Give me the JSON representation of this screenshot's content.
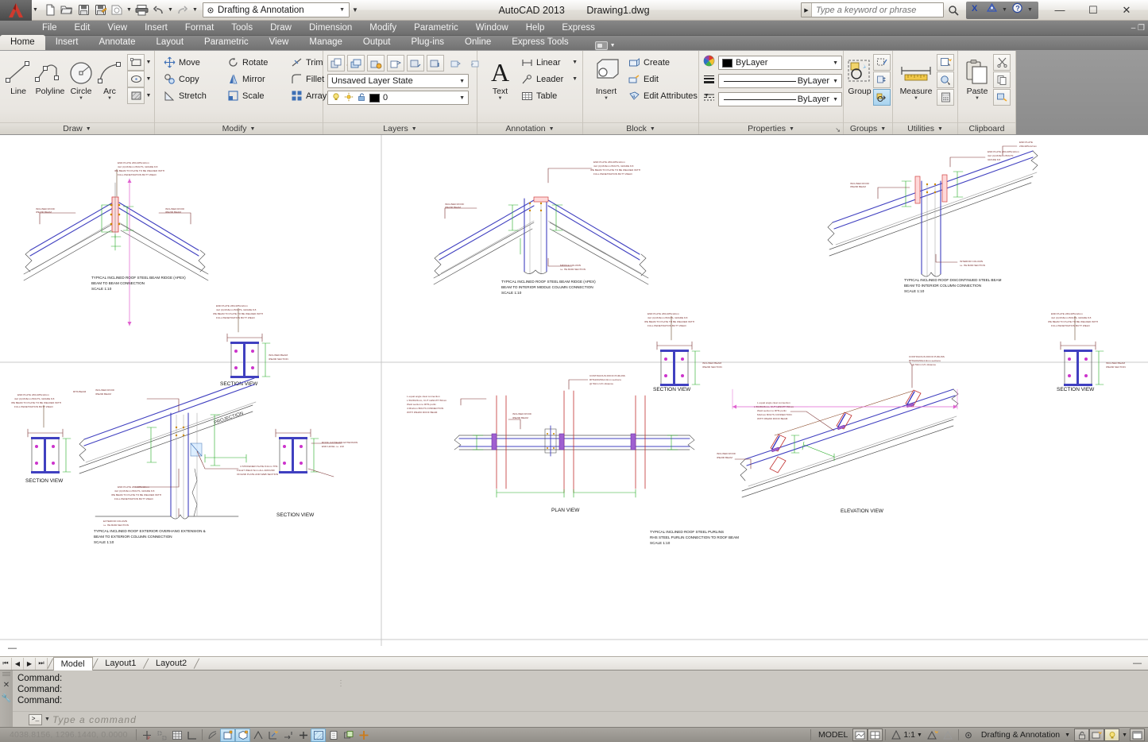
{
  "titlebar": {
    "app_name": "AutoCAD 2013",
    "document": "Drawing1.dwg",
    "workspace": "Drafting & Annotation",
    "quick_access": [
      {
        "name": "new-button",
        "label": "New"
      },
      {
        "name": "open-button",
        "label": "Open"
      },
      {
        "name": "save-button",
        "label": "Save"
      },
      {
        "name": "saveas-button",
        "label": "Save As"
      },
      {
        "name": "plot-preview-button",
        "label": "Plot Preview"
      },
      {
        "name": "plot-button",
        "label": "Plot"
      },
      {
        "name": "undo-button",
        "label": "Undo"
      },
      {
        "name": "redo-button",
        "label": "Redo"
      }
    ],
    "search_placeholder": "Type a keyword or phrase",
    "minimize": "—",
    "maximize": "☐",
    "close": "✕"
  },
  "menubar": {
    "items": [
      "File",
      "Edit",
      "View",
      "Insert",
      "Format",
      "Tools",
      "Draw",
      "Dimension",
      "Modify",
      "Parametric",
      "Window",
      "Help",
      "Express"
    ],
    "restore_glyph": "– ❐"
  },
  "ribbon_tabs": {
    "items": [
      "Home",
      "Insert",
      "Annotate",
      "Layout",
      "Parametric",
      "View",
      "Manage",
      "Output",
      "Plug-ins",
      "Online",
      "Express Tools"
    ],
    "active": "Home"
  },
  "panels": {
    "draw": {
      "title": "Draw",
      "big_buttons": [
        {
          "name": "line-tool",
          "label": "Line",
          "has_dropdown": false
        },
        {
          "name": "polyline-tool",
          "label": "Polyline",
          "has_dropdown": false
        },
        {
          "name": "circle-tool",
          "label": "Circle",
          "has_dropdown": true
        },
        {
          "name": "arc-tool",
          "label": "Arc",
          "has_dropdown": true
        }
      ],
      "small_buttons": [
        {
          "name": "rectangle-tool",
          "label": "Rectangle"
        },
        {
          "name": "ellipse-tool",
          "label": "Ellipse"
        },
        {
          "name": "hatch-tool",
          "label": "Hatch"
        }
      ]
    },
    "modify": {
      "title": "Modify",
      "items": [
        {
          "name": "move-tool",
          "label": "Move",
          "dropdown": false
        },
        {
          "name": "rotate-tool",
          "label": "Rotate",
          "dropdown": false
        },
        {
          "name": "trim-tool",
          "label": "Trim",
          "dropdown": true
        },
        {
          "name": "copy-tool",
          "label": "Copy",
          "dropdown": false
        },
        {
          "name": "mirror-tool",
          "label": "Mirror",
          "dropdown": false
        },
        {
          "name": "fillet-tool",
          "label": "Fillet",
          "dropdown": true
        },
        {
          "name": "stretch-tool",
          "label": "Stretch",
          "dropdown": false
        },
        {
          "name": "scale-tool",
          "label": "Scale",
          "dropdown": false
        },
        {
          "name": "array-tool",
          "label": "Array",
          "dropdown": true
        }
      ]
    },
    "layers": {
      "title": "Layers",
      "layer_state": "Unsaved Layer State",
      "current_layer": "0",
      "layer_color": "#000000"
    },
    "annotation": {
      "title": "Annotation",
      "text_label": "Text",
      "items": [
        {
          "name": "linear-dimension-tool",
          "label": "Linear",
          "dropdown": true
        },
        {
          "name": "leader-tool",
          "label": "Leader",
          "dropdown": true
        },
        {
          "name": "table-tool",
          "label": "Table",
          "dropdown": false
        }
      ]
    },
    "block": {
      "title": "Block",
      "insert_label": "Insert",
      "items": [
        {
          "name": "create-block-tool",
          "label": "Create",
          "dropdown": false
        },
        {
          "name": "edit-block-tool",
          "label": "Edit",
          "dropdown": false
        },
        {
          "name": "edit-attributes-tool",
          "label": "Edit Attributes",
          "dropdown": true
        }
      ]
    },
    "properties": {
      "title": "Properties",
      "color": "ByLayer",
      "linewidth": "ByLayer",
      "linetype": "ByLayer",
      "color_swatch": "#000000"
    },
    "groups": {
      "title": "Groups",
      "group_label": "Group"
    },
    "utilities": {
      "title": "Utilities",
      "measure_label": "Measure"
    },
    "clipboard": {
      "title": "Clipboard",
      "paste_label": "Paste"
    }
  },
  "drawing": {
    "details": [
      {
        "name": "detail-ridge-beam-to-beam",
        "title_lines": [
          "TYPICAL INCLINED ROOF STEEL BEAM RIDGE (APEX)",
          "BEAM TO BEAM CONNECTION",
          "SCALE 1:10"
        ],
        "section_label": "SECTION VIEW",
        "notes": [
          "END PLATE 230x185x12mm",
          "4x2 (4) M16mm BOLTS, GRADE 8.8",
          "IPE BEAM TO PLATE TO BE WELDED WITH",
          "FULL PENETRATION BUTT WELD",
          "INCLINED ROOF IPE200 BEAM"
        ]
      },
      {
        "name": "detail-ridge-to-middle-column",
        "title_lines": [
          "TYPICAL INCLINED ROOF STEEL BEAM RIDGE (APEX)",
          "BEAM TO INTERIOR MIDDLE COLUMN CONNECTION",
          "SCALE 1:10"
        ],
        "section_label": "SECTION VIEW",
        "notes": [
          "END PLATE 230x185x12mm",
          "4x2 (4) M16mm BOLTS, GRADE 8.8",
          "IPE BEAM TO PLATE TO BE WELDED WITH",
          "FULL PENETRATION BUTT WELD",
          "MIDDLE COLUMN i.e. HE B200 SECTION"
        ]
      },
      {
        "name": "detail-discontinued-beam-to-interior-column",
        "title_lines": [
          "TYPICAL INCLINED ROOF DISCONTINUED STEEL BEAM",
          "BEAM TO INTERIOR COLUMN CONNECTION",
          "SCALE 1:10"
        ],
        "section_label": "SECTION VIEW",
        "notes": [
          "END PLATE 230x185x12mm",
          "4x2 (4) M16mm BOLTS, GRADE 8.8",
          "IPE BEAM TO PLATE TO BE WELDED WITH",
          "FULL PENETRATION BUTT WELD",
          "INTERIOR COLUMN i.e. HE B200 SECTION"
        ]
      },
      {
        "name": "detail-exterior-overhang-extension",
        "title_lines": [
          "TYPICAL INCLINED ROOF EXTERIOR OVERHANG  EXTENSION &",
          "BEAM TO EXTERIOR COLUMN CONNECTION",
          "SCALE 1:10"
        ],
        "section_label": "SECTION VIEW",
        "notes": [
          "END PLATE 230x185x12mm",
          "4x2 (4) M16mm BOLTS, GRADE 8.8",
          "IPE BEAM TO PLATE TO BE WELDED WITH",
          "FULL PENETRATION BUTT WELD",
          "EXTERIOR COLUMN i.e. HE B200 SECTION",
          "INCLINED ROOF IPE200 BEAM",
          "ROOF 2x8 BEAMS EXTENSION",
          "4 STIFFENER PLATE 8.0mm THK.",
          "FILLET WELD 6mm ALL AROUND",
          "ON END PLATE AND WEB SECTION"
        ]
      },
      {
        "name": "detail-roof-purlins-plan",
        "title_lines": [
          "TYPICAL INCLINED ROOF STEEL PURLINS",
          "RHS STEEL PURLIN CONNECTION TO ROOF BEAM",
          "SCALE 1:10"
        ],
        "section_label": "PLAN VIEW",
        "notes": [
          "CONTINUOUS ROOF PURLINS",
          "RHS100x50x4.0mm sections",
          "@ 50cm C/C distance"
        ]
      },
      {
        "name": "detail-roof-purlins-elevation",
        "title_lines": [],
        "section_label": "ELEVATION VIEW",
        "notes": [
          "CONTINUOUS ROOF PURLINS",
          "RHS100x50x4.0mm sections",
          "@ 50cm C/C distance",
          "L equal angle cleat connection",
          "L 50x50x5mm, CUT LENGTH 50mm",
          "Weld section to RHS purlin",
          "M12mm BOLTS CONNECTION",
          "WITH IPE200 ROOF BEAM",
          "INCLINED ROOF IPE200 BEAM"
        ]
      }
    ]
  },
  "layout_tabs": {
    "nav": [
      "⏮",
      "◀",
      "▶",
      "⏭"
    ],
    "items": [
      "Model",
      "Layout1",
      "Layout2"
    ],
    "active": "Model",
    "restore_glyph": "—"
  },
  "command_window": {
    "history": [
      "Command:",
      "Command:",
      "Command:"
    ],
    "prompt_glyph": ">_",
    "input_placeholder": "Type a command"
  },
  "statusbar": {
    "coordinates": "4038.8156, 1296.1440, 0.0000",
    "toggles": [
      {
        "name": "infer-constraints-toggle",
        "label": "Infer Constraints",
        "on": false
      },
      {
        "name": "snap-mode-toggle",
        "label": "Snap Mode",
        "on": false
      },
      {
        "name": "grid-display-toggle",
        "label": "Grid Display",
        "on": false
      },
      {
        "name": "ortho-mode-toggle",
        "label": "Ortho Mode",
        "on": false
      },
      {
        "name": "polar-tracking-toggle",
        "label": "Polar Tracking",
        "on": false
      },
      {
        "name": "object-snap-toggle",
        "label": "Object Snap",
        "on": true
      },
      {
        "name": "3d-object-snap-toggle",
        "label": "3D Object Snap",
        "on": false
      },
      {
        "name": "object-snap-tracking-toggle",
        "label": "Object Snap Tracking",
        "on": false
      },
      {
        "name": "dynamic-ucs-toggle",
        "label": "Allow/Disallow Dynamic UCS",
        "on": false
      },
      {
        "name": "dynamic-input-toggle",
        "label": "Dynamic Input",
        "on": false
      },
      {
        "name": "lineweight-toggle",
        "label": "Show/Hide Lineweight",
        "on": false
      },
      {
        "name": "transparency-toggle",
        "label": "Show/Hide Transparency",
        "on": true
      },
      {
        "name": "quick-properties-toggle",
        "label": "Quick Properties",
        "on": false
      },
      {
        "name": "selection-cycling-toggle",
        "label": "Selection Cycling",
        "on": false
      },
      {
        "name": "annotation-monitor-toggle",
        "label": "Annotation Monitor",
        "on": false
      }
    ],
    "space_label": "MODEL",
    "annotation_scale": "1:1",
    "workspace": "Drafting & Annotation"
  }
}
